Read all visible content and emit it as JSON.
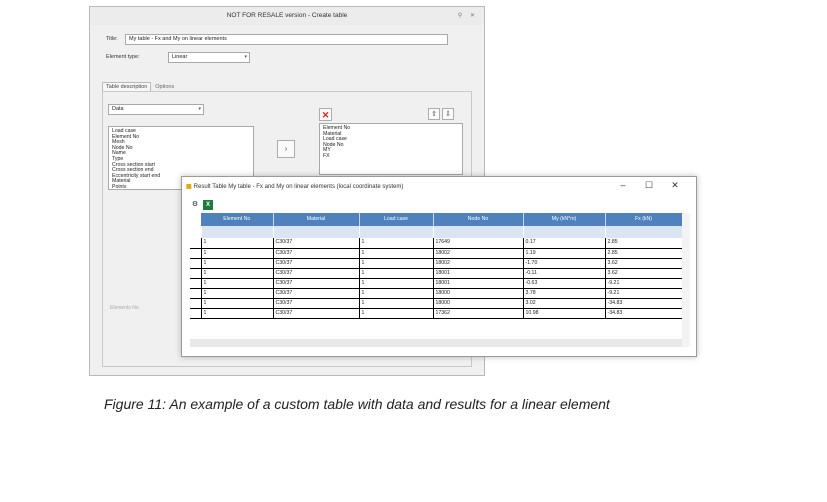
{
  "dialog": {
    "title": "NOT FOR RESALE version - Create table",
    "title_label": "Title:",
    "title_value": "My table - Fx and My on linear elements",
    "element_type_label": "Element type:",
    "element_type_value": "Linear",
    "tabs": [
      "Table description",
      "Options"
    ],
    "category_value": "Data",
    "available_items": [
      "Load case",
      "Element No",
      "Mesh",
      "Node No",
      "Name",
      "Type",
      "Cross section start",
      "Cross section end",
      "Eccentricity start end",
      "Material",
      "Points"
    ],
    "selected_items": [
      "Element No",
      "Material",
      "Load case",
      "Node No",
      "MY",
      "FX"
    ],
    "bottom_faint_label": "Elements No"
  },
  "result": {
    "title": "Result Table My table - Fx and My on linear elements (local coordinate system)",
    "controls": [
      "–",
      "☐",
      "✕"
    ],
    "columns": [
      "Element No",
      "Material",
      "Load case",
      "Node No",
      "My (kN*m)",
      "Fx (kN)"
    ],
    "rows": [
      [
        "1",
        "C30/37",
        "1",
        "17649",
        "0.17",
        "2.85"
      ],
      [
        "1",
        "C30/37",
        "1",
        "18002",
        "1.19",
        "2.85"
      ],
      [
        "1",
        "C30/37",
        "1",
        "18002",
        "-1.70",
        "3.62"
      ],
      [
        "1",
        "C30/37",
        "1",
        "18001",
        "-0.11",
        "3.62"
      ],
      [
        "1",
        "C30/37",
        "1",
        "18001",
        "-0.63",
        "-9.21"
      ],
      [
        "1",
        "C30/37",
        "1",
        "18000",
        "3.78",
        "-9.21"
      ],
      [
        "1",
        "C30/37",
        "1",
        "18000",
        "3.02",
        "-34.83"
      ],
      [
        "1",
        "C30/37",
        "1",
        "17362",
        "10.98",
        "-34.83"
      ]
    ]
  },
  "caption": "Figure 11:  An example of a custom table with data and results for a linear element"
}
